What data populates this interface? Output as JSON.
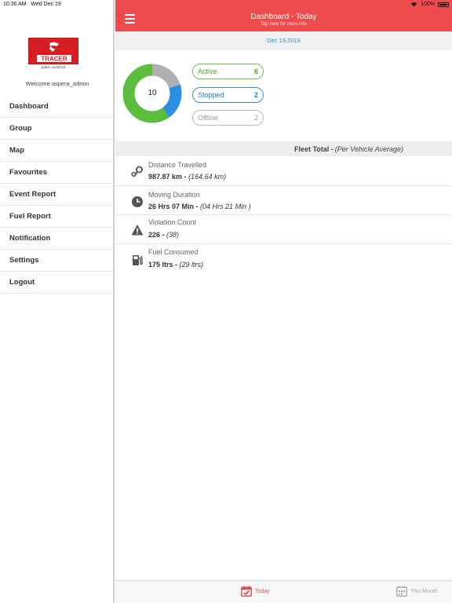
{
  "status_bar": {
    "time": "10:36 AM",
    "date": "Wed Dec 19",
    "battery": "100%"
  },
  "sidebar": {
    "logo_tagline": "take control",
    "welcome": "Welcome aspera_admin",
    "items": [
      {
        "label": "Dashboard"
      },
      {
        "label": "Group"
      },
      {
        "label": "Map"
      },
      {
        "label": "Favourites"
      },
      {
        "label": "Event Report"
      },
      {
        "label": "Fuel Report"
      },
      {
        "label": "Notification"
      },
      {
        "label": "Settings"
      },
      {
        "label": "Logout"
      }
    ]
  },
  "header": {
    "title": "Dashboard - Today",
    "subtitle": "Tap here for more info"
  },
  "date": "Dec 19,2018",
  "vehicles": {
    "total": "10",
    "active": {
      "label": "Active",
      "count": "6"
    },
    "stopped": {
      "label": "Stopped",
      "count": "2"
    },
    "offline": {
      "label": "Offline",
      "count": "2"
    }
  },
  "fleet": {
    "title": "Fleet Total -",
    "note": "(Per Vehicle Average)"
  },
  "stats": [
    {
      "label": "Distance Travelled",
      "total": "987.87 km -",
      "avg": "(164.64 km)",
      "icon": "location-pins-icon"
    },
    {
      "label": "Moving Duration",
      "total": "26 Hrs 07 Min  -",
      "avg": "(04 Hrs 21 Min )",
      "icon": "clock-icon"
    },
    {
      "label": "Violation Count",
      "total": "226 -",
      "avg": "(38)",
      "icon": "warning-icon"
    },
    {
      "label": "Fuel Consumed",
      "total": "175 ltrs -",
      "avg": "(29 ltrs)",
      "icon": "fuel-pump-icon"
    }
  ],
  "tabs": {
    "today": "Today",
    "month": "This Month"
  },
  "colors": {
    "header": "#ee4c4c",
    "active": "#6cc04a",
    "stopped": "#2d8fe0",
    "offline": "#b9b9b9"
  }
}
